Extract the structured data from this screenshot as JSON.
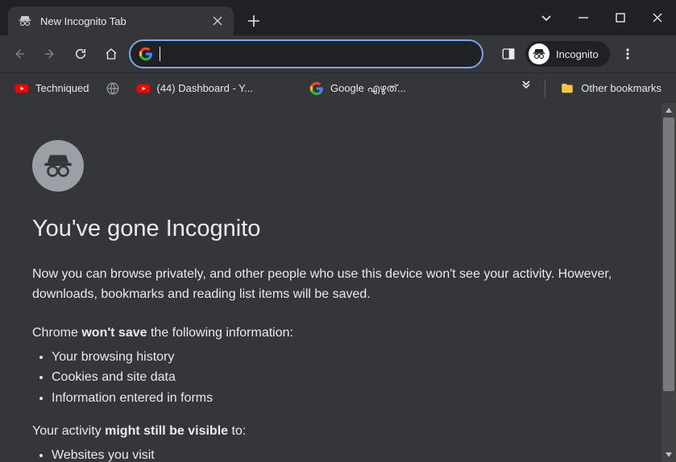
{
  "tab": {
    "title": "New Incognito Tab"
  },
  "toolbar": {
    "omnibox_value": "",
    "incognito_label": "Incognito"
  },
  "bookmarks": {
    "items": [
      {
        "label": "Techniqued",
        "icon": "youtube"
      },
      {
        "label": "",
        "icon": "globe"
      },
      {
        "label": "(44) Dashboard - Y...",
        "icon": "youtube"
      },
      {
        "label": "Google എഴുത്...",
        "icon": "google"
      }
    ],
    "other_label": "Other bookmarks"
  },
  "page": {
    "heading": "You've gone Incognito",
    "lead": "Now you can browse privately, and other people who use this device won't see your activity. However, downloads, bookmarks and reading list items will be saved.",
    "wont_save_prefix": "Chrome ",
    "wont_save_bold": "won't save",
    "wont_save_suffix": " the following information:",
    "wont_save_items": [
      "Your browsing history",
      "Cookies and site data",
      "Information entered in forms"
    ],
    "might_visible_prefix": "Your activity ",
    "might_visible_bold": "might still be visible",
    "might_visible_suffix": " to:",
    "might_visible_items": [
      "Websites you visit"
    ]
  }
}
